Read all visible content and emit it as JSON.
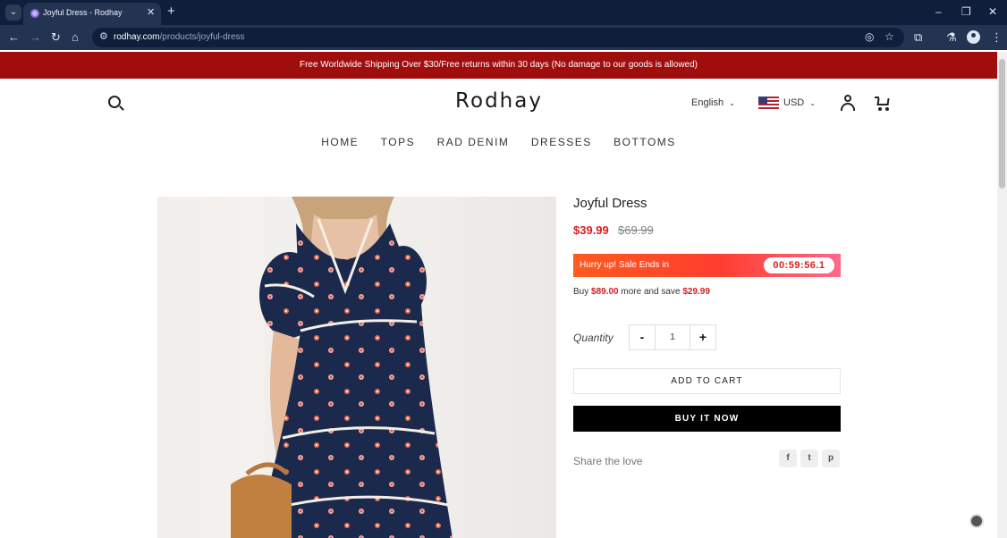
{
  "browser": {
    "tab_title": "Joyful Dress - Rodhay",
    "tab_close": "✕",
    "new_tab": "+",
    "url_host": "rodhay.com",
    "url_path": "/products/joyful-dress",
    "window_controls": [
      "–",
      "❐",
      "✕"
    ]
  },
  "announcement": "Free Worldwide Shipping Over $30/Free returns within 30 days (No damage to our goods is allowed)",
  "header": {
    "logo": "Rodhay",
    "language": "English",
    "currency": "USD",
    "nav": [
      "HOME",
      "TOPS",
      "RAD DENIM",
      "DRESSES",
      "BOTTOMS"
    ]
  },
  "product": {
    "title": "Joyful Dress",
    "price": "$39.99",
    "compare_price": "$69.99",
    "sale_text": "Hurry up! Sale Ends in",
    "timer": "00:59:56.1",
    "bundle_prefix": "Buy",
    "bundle_amount": "$89.00",
    "bundle_middle": "more and save",
    "bundle_save": "$29.99",
    "quantity_label": "Quantity",
    "quantity": "1",
    "minus": "-",
    "plus": "+",
    "add_to_cart": "ADD TO CART",
    "buy_now": "BUY IT NOW",
    "share_label": "Share the love"
  },
  "share_icons": [
    "facebook-icon",
    "twitter-icon",
    "pinterest-icon"
  ]
}
